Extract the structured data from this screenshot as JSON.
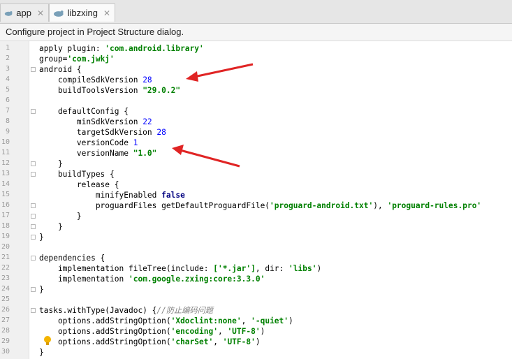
{
  "tabs": [
    {
      "label": "app",
      "active": false
    },
    {
      "label": "libzxing",
      "active": true
    }
  ],
  "banner": {
    "text": "Configure project in Project Structure dialog."
  },
  "code_lines": [
    [
      [
        "apply plugin: ",
        "plain"
      ],
      [
        "'com.android.library'",
        "str"
      ]
    ],
    [
      [
        "group=",
        "plain"
      ],
      [
        "'com.jwkj'",
        "str"
      ]
    ],
    [
      [
        "android {",
        "plain"
      ]
    ],
    [
      [
        "    compileSdkVersion ",
        "plain"
      ],
      [
        "28",
        "num"
      ]
    ],
    [
      [
        "    buildToolsVersion ",
        "plain"
      ],
      [
        "\"29.0.2\"",
        "str"
      ]
    ],
    [
      [
        "",
        "plain"
      ]
    ],
    [
      [
        "    defaultConfig {",
        "plain"
      ]
    ],
    [
      [
        "        minSdkVersion ",
        "plain"
      ],
      [
        "22",
        "num"
      ]
    ],
    [
      [
        "        targetSdkVersion ",
        "plain"
      ],
      [
        "28",
        "num"
      ]
    ],
    [
      [
        "        versionCode ",
        "plain"
      ],
      [
        "1",
        "num"
      ]
    ],
    [
      [
        "        versionName ",
        "plain"
      ],
      [
        "\"1.0\"",
        "str"
      ]
    ],
    [
      [
        "    }",
        "plain"
      ]
    ],
    [
      [
        "    buildTypes {",
        "plain"
      ]
    ],
    [
      [
        "        release {",
        "plain"
      ]
    ],
    [
      [
        "            minifyEnabled ",
        "plain"
      ],
      [
        "false",
        "kw"
      ]
    ],
    [
      [
        "            proguardFiles getDefaultProguardFile(",
        "plain"
      ],
      [
        "'proguard-android.txt'",
        "str"
      ],
      [
        "), ",
        "plain"
      ],
      [
        "'proguard-rules.pro'",
        "str"
      ]
    ],
    [
      [
        "        }",
        "plain"
      ]
    ],
    [
      [
        "    }",
        "plain"
      ]
    ],
    [
      [
        "}",
        "plain"
      ]
    ],
    [
      [
        "",
        "plain"
      ]
    ],
    [
      [
        "dependencies {",
        "plain"
      ]
    ],
    [
      [
        "    implementation fileTree(",
        "plain"
      ],
      [
        "include: ",
        "plain"
      ],
      [
        "['*.jar']",
        "str"
      ],
      [
        ", ",
        "plain"
      ],
      [
        "dir: ",
        "plain"
      ],
      [
        "'libs'",
        "str"
      ],
      [
        ")",
        "plain"
      ]
    ],
    [
      [
        "    implementation ",
        "plain"
      ],
      [
        "'com.google.zxing:core:3.3.0'",
        "str"
      ]
    ],
    [
      [
        "}",
        "plain"
      ]
    ],
    [
      [
        "",
        "plain"
      ]
    ],
    [
      [
        "tasks.withType(Javadoc) {",
        "plain"
      ],
      [
        "//防止编码问题",
        "cmt"
      ]
    ],
    [
      [
        "    options.addStringOption(",
        "plain"
      ],
      [
        "'Xdoclint:none'",
        "str"
      ],
      [
        ", ",
        "plain"
      ],
      [
        "'-quiet'",
        "str"
      ],
      [
        ")",
        "plain"
      ]
    ],
    [
      [
        "    options.addStringOption(",
        "plain"
      ],
      [
        "'encoding'",
        "str"
      ],
      [
        ", ",
        "plain"
      ],
      [
        "'UTF-8'",
        "str"
      ],
      [
        ")",
        "plain"
      ]
    ],
    [
      [
        "    options.addStringOption(",
        "plain"
      ],
      [
        "'charSet'",
        "str"
      ],
      [
        ", ",
        "plain"
      ],
      [
        "'UTF-8'",
        "str"
      ],
      [
        ")",
        "plain"
      ]
    ],
    [
      [
        "}",
        "plain"
      ]
    ]
  ],
  "line_numbers": [
    "1",
    "2",
    "3",
    "4",
    "5",
    "6",
    "7",
    "8",
    "9",
    "10",
    "11",
    "12",
    "13",
    "14",
    "15",
    "16",
    "17",
    "18",
    "19",
    "20",
    "21",
    "22",
    "23",
    "24",
    "25",
    "26",
    "27",
    "28",
    "29",
    "30"
  ],
  "fold_lines": [
    3,
    7,
    12,
    13,
    16,
    17,
    18,
    19,
    21,
    24,
    26
  ],
  "colors": {
    "arrow": "#e02424",
    "bulb": "#f4b400"
  }
}
